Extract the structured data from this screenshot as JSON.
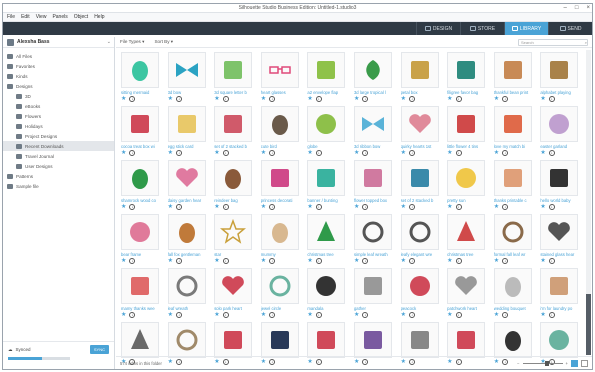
{
  "window": {
    "title": "Silhouette Studio Business Edition: Untitled-1.studio3"
  },
  "menu": [
    "File",
    "Edit",
    "View",
    "Panels",
    "Object",
    "Help"
  ],
  "tabs": [
    {
      "label": "DESIGN",
      "active": false
    },
    {
      "label": "STORE",
      "active": false
    },
    {
      "label": "LIBRARY",
      "active": true
    },
    {
      "label": "SEND",
      "active": false
    }
  ],
  "sidebar": {
    "user": "Alexsha Bass",
    "items": [
      {
        "label": "All Files",
        "count": "",
        "indent": 0,
        "selected": false
      },
      {
        "label": "Favorites",
        "count": "",
        "indent": 0,
        "selected": false
      },
      {
        "label": "Kinds",
        "count": "",
        "indent": 0,
        "selected": false
      },
      {
        "label": "Designs",
        "count": "",
        "indent": 0,
        "selected": false
      },
      {
        "label": "3D",
        "count": "",
        "indent": 1,
        "selected": false
      },
      {
        "label": "eBooks",
        "count": "",
        "indent": 1,
        "selected": false
      },
      {
        "label": "Flowers",
        "count": "",
        "indent": 1,
        "selected": false
      },
      {
        "label": "Holidays",
        "count": "",
        "indent": 1,
        "selected": false
      },
      {
        "label": "Project Designs",
        "count": "",
        "indent": 1,
        "selected": false
      },
      {
        "label": "Recent Downloads",
        "count": "",
        "indent": 1,
        "selected": true
      },
      {
        "label": "Travel Journal",
        "count": "",
        "indent": 1,
        "selected": false
      },
      {
        "label": "User Designs",
        "count": "",
        "indent": 1,
        "selected": false
      },
      {
        "label": "Patterns",
        "count": "",
        "indent": 0,
        "selected": false
      },
      {
        "label": "Sample file",
        "count": "",
        "indent": 0,
        "selected": false
      }
    ],
    "sync_label": "Synced",
    "sync_button": "SYNC",
    "sync_progress": 0.55
  },
  "toolbar": {
    "file_types": "File Types",
    "sort_by": "Sort By",
    "search_placeholder": "Search"
  },
  "items": [
    {
      "label": "sitting mermaid",
      "color": "#3cc6a2",
      "shape": "blob"
    },
    {
      "label": "3d bow",
      "color": "#2ba3c3",
      "shape": "bow"
    },
    {
      "label": "3d square letter b",
      "color": "#7ec36a",
      "shape": "square"
    },
    {
      "label": "heart glasses",
      "color": "#e04a7a",
      "shape": "glasses"
    },
    {
      "label": "a2 envelope flap",
      "color": "#8fc24a",
      "shape": "square"
    },
    {
      "label": "3d large tropical l",
      "color": "#3a9b4a",
      "shape": "leaf"
    },
    {
      "label": "petal box",
      "color": "#c9a24a",
      "shape": "square"
    },
    {
      "label": "filigree favor bag",
      "color": "#2f8c80",
      "shape": "square"
    },
    {
      "label": "thankful bean print",
      "color": "#c88a56",
      "shape": "square"
    },
    {
      "label": "alphabet playing",
      "color": "#a9824a",
      "shape": "square"
    },
    {
      "label": "cocoa treat box wi",
      "color": "#d04a5a",
      "shape": "square"
    },
    {
      "label": "egg stick card",
      "color": "#e9c96a",
      "shape": "square"
    },
    {
      "label": "set of 2 stacked b",
      "color": "#d05a6a",
      "shape": "square"
    },
    {
      "label": "cute bird",
      "color": "#6a5a4a",
      "shape": "blob"
    },
    {
      "label": "globe",
      "color": "#8ec04a",
      "shape": "circle"
    },
    {
      "label": "3d ribbon bow",
      "color": "#5ab3d8",
      "shape": "bow"
    },
    {
      "label": "quirky hearts 1st",
      "color": "#e08a9a",
      "shape": "heart"
    },
    {
      "label": "little flower 4 tins",
      "color": "#d04a4a",
      "shape": "square"
    },
    {
      "label": "love my match bi",
      "color": "#e06a4a",
      "shape": "square"
    },
    {
      "label": "easter garland",
      "color": "#c0a0d0",
      "shape": "circle"
    },
    {
      "label": "shamrock wood co",
      "color": "#2f9a4a",
      "shape": "blob"
    },
    {
      "label": "daisy garden hear",
      "color": "#e07aa0",
      "shape": "heart"
    },
    {
      "label": "reindeer bag",
      "color": "#8a5a3a",
      "shape": "blob"
    },
    {
      "label": "princess decorati",
      "color": "#d04a8a",
      "shape": "square"
    },
    {
      "label": "banner / bunting",
      "color": "#3ab3a0",
      "shape": "square"
    },
    {
      "label": "flower topped box",
      "color": "#d07aa0",
      "shape": "square"
    },
    {
      "label": "set of 2 stacked b",
      "color": "#3a8aaa",
      "shape": "square"
    },
    {
      "label": "pretty sun",
      "color": "#f0c84a",
      "shape": "circle"
    },
    {
      "label": "thanks printable c",
      "color": "#e0a07a",
      "shape": "square"
    },
    {
      "label": "hello world baby",
      "color": "#333333",
      "shape": "square"
    },
    {
      "label": "bear frame",
      "color": "#e07a9a",
      "shape": "circle"
    },
    {
      "label": "fall fox gentleman",
      "color": "#c07a3a",
      "shape": "blob"
    },
    {
      "label": "star",
      "color": "#c9a03a",
      "shape": "star"
    },
    {
      "label": "mummy",
      "color": "#d8b890",
      "shape": "blob"
    },
    {
      "label": "christmas tree",
      "color": "#2f9a4a",
      "shape": "tree"
    },
    {
      "label": "simple leaf wreath",
      "color": "#555555",
      "shape": "ring"
    },
    {
      "label": "leafy elegant wre",
      "color": "#555555",
      "shape": "ring"
    },
    {
      "label": "christmas tree",
      "color": "#d04a4a",
      "shape": "tree"
    },
    {
      "label": "formal fall leaf wr",
      "color": "#8a6a4a",
      "shape": "ring"
    },
    {
      "label": "stained glass hear",
      "color": "#555555",
      "shape": "heart"
    },
    {
      "label": "mamy thanks wee",
      "color": "#e06a6a",
      "shape": "square"
    },
    {
      "label": "leaf wreath",
      "color": "#7a7a7a",
      "shape": "ring"
    },
    {
      "label": "solo park heart",
      "color": "#d04a5a",
      "shape": "heart"
    },
    {
      "label": "jewel circle",
      "color": "#6ab3a0",
      "shape": "ring"
    },
    {
      "label": "mandala",
      "color": "#333333",
      "shape": "circle"
    },
    {
      "label": "gather",
      "color": "#999999",
      "shape": "square"
    },
    {
      "label": "peacock",
      "color": "#d04a5a",
      "shape": "circle"
    },
    {
      "label": "patchwork heart",
      "color": "#999999",
      "shape": "heart"
    },
    {
      "label": "wedding bouquet",
      "color": "#bbbbbb",
      "shape": "blob"
    },
    {
      "label": "i'm for laundry po",
      "color": "#d0a07a",
      "shape": "square"
    },
    {
      "label": "",
      "color": "#6a6a6a",
      "shape": "tree"
    },
    {
      "label": "",
      "color": "#a08a6a",
      "shape": "ring"
    },
    {
      "label": "",
      "color": "#d04a5a",
      "shape": "square"
    },
    {
      "label": "",
      "color": "#2a3a5a",
      "shape": "square"
    },
    {
      "label": "",
      "color": "#d04a5a",
      "shape": "square"
    },
    {
      "label": "",
      "color": "#7a5aa0",
      "shape": "square"
    },
    {
      "label": "",
      "color": "#888888",
      "shape": "square"
    },
    {
      "label": "",
      "color": "#d04a5a",
      "shape": "square"
    },
    {
      "label": "",
      "color": "#333333",
      "shape": "blob"
    },
    {
      "label": "",
      "color": "#6ab3a0",
      "shape": "circle"
    }
  ],
  "status": {
    "count_text": "574 items in this folder"
  }
}
